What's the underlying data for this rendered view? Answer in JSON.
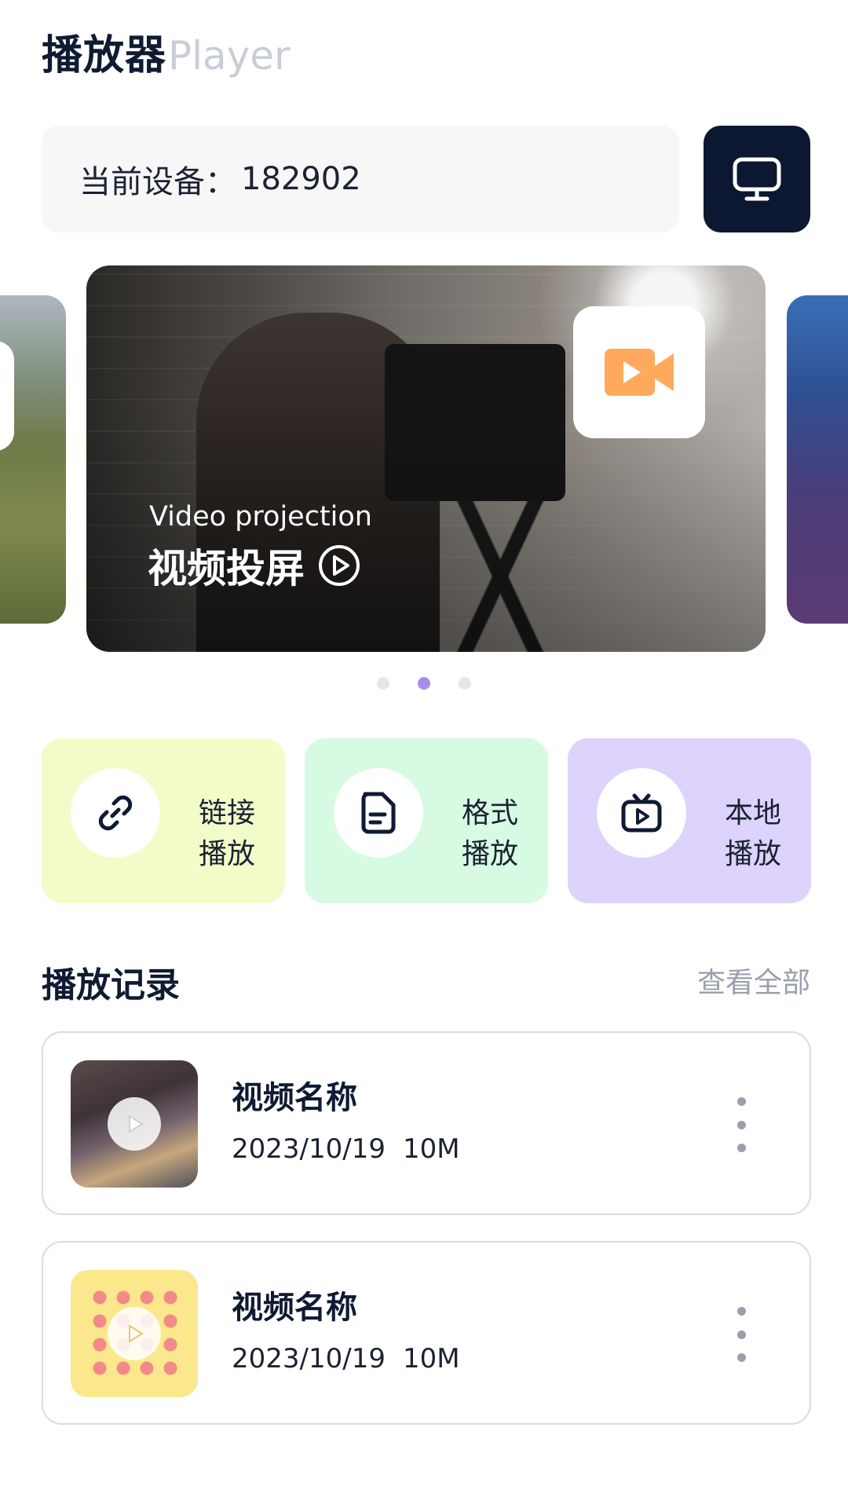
{
  "header": {
    "title_cn": "播放器",
    "title_en": "Player"
  },
  "device": {
    "label": "当前设备：",
    "value": "182902",
    "cast_icon": "monitor-icon"
  },
  "carousel": {
    "active_index": 1,
    "count": 3,
    "main": {
      "subtitle": "Video projection",
      "title": "视频投屏",
      "badge_icon": "video-camera-icon"
    }
  },
  "actions": [
    {
      "line1": "链接",
      "line2": "播放",
      "icon": "link-icon",
      "color": "#f2fcc9"
    },
    {
      "line1": "格式",
      "line2": "播放",
      "icon": "document-icon",
      "color": "#d6fbe2"
    },
    {
      "line1": "本地",
      "line2": "播放",
      "icon": "tv-play-icon",
      "color": "#ddd3fc"
    }
  ],
  "history": {
    "title": "播放记录",
    "view_all": "查看全部",
    "items": [
      {
        "name": "视频名称",
        "date": "2023/10/19",
        "size": "10M"
      },
      {
        "name": "视频名称",
        "date": "2023/10/19",
        "size": "10M"
      }
    ]
  },
  "colors": {
    "accent": "#a98bea",
    "dark": "#0c1731",
    "orange": "#ffa95c"
  }
}
